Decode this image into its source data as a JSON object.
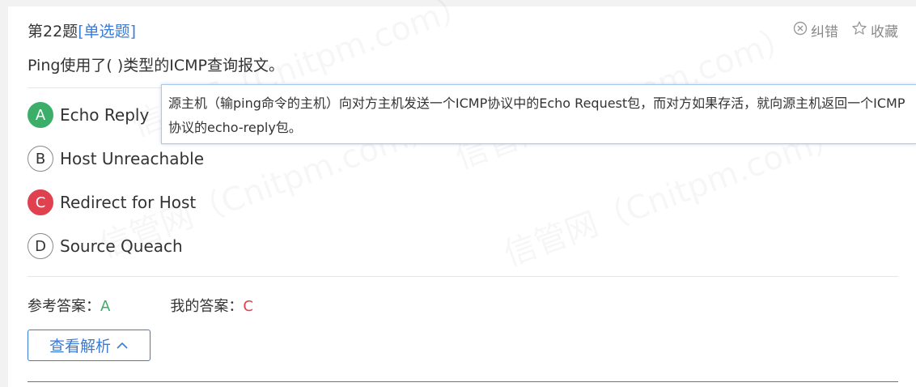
{
  "question": {
    "number_label": "第22题",
    "type_label": "[单选题]",
    "text": "Ping使用了( )类型的ICMP查询报文。"
  },
  "tools": {
    "report_label": "纠错",
    "favorite_label": "收藏"
  },
  "watermark": {
    "text": "信管网（Cnitpm.com）"
  },
  "tooltip": {
    "text": "源主机（输ping命令的主机）向对方主机发送一个ICMP协议中的Echo Request包，而对方如果存活，就向源主机返回一个ICMP协议的echo-reply包。"
  },
  "options": [
    {
      "letter": "A",
      "text": "Echo Reply",
      "state": "correct"
    },
    {
      "letter": "B",
      "text": "Host Unreachable",
      "state": "normal"
    },
    {
      "letter": "C",
      "text": "Redirect for Host",
      "state": "wrong"
    },
    {
      "letter": "D",
      "text": "Source Queach",
      "state": "normal"
    }
  ],
  "answers": {
    "reference_label": "参考答案：",
    "reference_value": "A",
    "mine_label": "我的答案：",
    "mine_value": "C"
  },
  "analysis_button": {
    "label": "查看解析"
  },
  "colors": {
    "accent": "#3a7bd5",
    "correct": "#3dae6a",
    "wrong": "#e0414f"
  }
}
